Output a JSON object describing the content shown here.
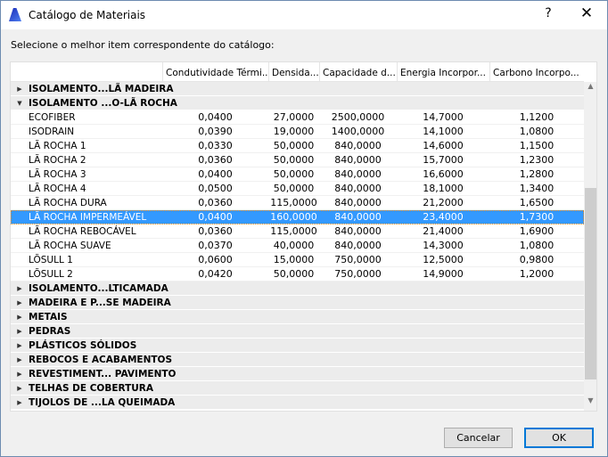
{
  "window": {
    "title": "Catálogo de Materiais",
    "help": "?",
    "close": "✕"
  },
  "prompt": "Selecione o melhor item correspondente do catálogo:",
  "columns": [
    "",
    "Condutividade Térmi...",
    "Densida...",
    "Capacidade d...",
    "Energia Incorpor...",
    "Carbono Incorpo..."
  ],
  "groups_top": [
    {
      "label": "ISOLAMENTO...LÃ MADEIRA",
      "expanded": false
    },
    {
      "label": "ISOLAMENTO ...O-LÃ ROCHA",
      "expanded": true
    }
  ],
  "rows": [
    [
      "ECOFIBER",
      "0,0400",
      "27,0000",
      "2500,0000",
      "14,7000",
      "1,1200"
    ],
    [
      "ISODRAIN",
      "0,0390",
      "19,0000",
      "1400,0000",
      "14,1000",
      "1,0800"
    ],
    [
      "LÃ ROCHA 1",
      "0,0330",
      "50,0000",
      "840,0000",
      "14,6000",
      "1,1500"
    ],
    [
      "LÃ ROCHA 2",
      "0,0360",
      "50,0000",
      "840,0000",
      "15,7000",
      "1,2300"
    ],
    [
      "LÃ ROCHA 3",
      "0,0400",
      "50,0000",
      "840,0000",
      "16,6000",
      "1,2800"
    ],
    [
      "LÃ ROCHA 4",
      "0,0500",
      "50,0000",
      "840,0000",
      "18,1000",
      "1,3400"
    ],
    [
      "LÃ ROCHA DURA",
      "0,0360",
      "115,0000",
      "840,0000",
      "21,2000",
      "1,6500"
    ],
    [
      "LÃ ROCHA IMPERMEÁVEL",
      "0,0400",
      "160,0000",
      "840,0000",
      "23,4000",
      "1,7300"
    ],
    [
      "LÃ ROCHA REBOCÁVEL",
      "0,0360",
      "115,0000",
      "840,0000",
      "21,4000",
      "1,6900"
    ],
    [
      "LÃ ROCHA SUAVE",
      "0,0370",
      "40,0000",
      "840,0000",
      "14,3000",
      "1,0800"
    ],
    [
      "LÕSULL 1",
      "0,0600",
      "15,0000",
      "750,0000",
      "12,5000",
      "0,9800"
    ],
    [
      "LÕSULL 2",
      "0,0420",
      "50,0000",
      "750,0000",
      "14,9000",
      "1,2000"
    ]
  ],
  "selected_row": 7,
  "groups_bottom": [
    "ISOLAMENTO...LTICAMADA",
    "MADEIRA E P...SE MADEIRA",
    "METAIS",
    "PEDRAS",
    "PLÁSTICOS SÓLIDOS",
    "REBOCOS E ACABAMENTOS",
    "REVESTIMENT... PAVIMENTO",
    "TELHAS DE COBERTURA",
    "TIJOLOS DE ...LA QUEIMADA"
  ],
  "buttons": {
    "cancel": "Cancelar",
    "ok": "OK"
  }
}
